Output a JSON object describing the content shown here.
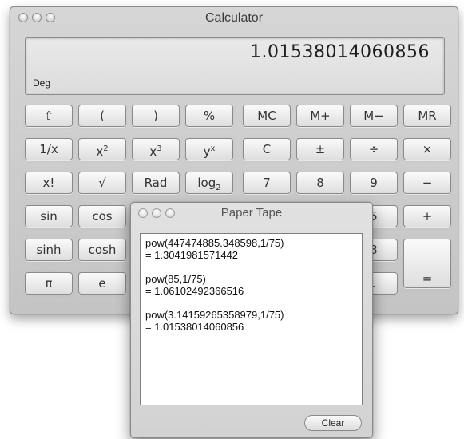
{
  "calculator": {
    "title": "Calculator",
    "display_value": "1.01538014060856",
    "angle_mode": "Deg",
    "keys": {
      "shift": "⇧",
      "open_paren": "(",
      "close_paren": ")",
      "percent": "%",
      "mc": "MC",
      "m_plus": "M+",
      "m_minus": "M−",
      "mr": "MR",
      "reciprocal": "1/x",
      "x_squared_base": "x",
      "x_squared_exp": "2",
      "x_cubed_base": "x",
      "x_cubed_exp": "3",
      "y_pow_x_base": "y",
      "y_pow_x_exp": "x",
      "clear": "C",
      "plus_minus": "±",
      "divide": "÷",
      "multiply": "×",
      "factorial": "x!",
      "sqrt": "√",
      "rad": "Rad",
      "log2_base": "log",
      "log2_sub": "2",
      "seven": "7",
      "eight": "8",
      "nine": "9",
      "minus": "−",
      "sin": "sin",
      "cos": "cos",
      "five": "5",
      "plus": "+",
      "sinh": "sinh",
      "cosh": "cosh",
      "three": "3",
      "pi": "π",
      "e": "e",
      "decimal": ".",
      "equals": "="
    }
  },
  "paper_tape": {
    "title": "Paper Tape",
    "entries": [
      {
        "expression": "pow(447474885.348598,1/75)",
        "result": "= 1.3041981571442"
      },
      {
        "expression": "pow(85,1/75)",
        "result": "= 1.06102492366516"
      },
      {
        "expression": "pow(3.14159265358979,1/75)",
        "result": "= 1.01538014060856"
      }
    ],
    "clear_label": "Clear"
  }
}
